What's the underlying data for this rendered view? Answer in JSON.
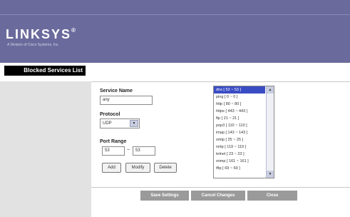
{
  "brand": {
    "logo": "LINKSYS",
    "registered": "®",
    "tagline": "A Division of Cisco Systems, Inc."
  },
  "sidebar": {
    "title": "Blocked Services List"
  },
  "form": {
    "service_name_label": "Service Name",
    "service_name_value": "any",
    "protocol_label": "Protocol",
    "protocol_value": "UDP",
    "port_range_label": "Port Range",
    "port_from": "53",
    "port_separator": "~",
    "port_to": "53",
    "add_label": "Add",
    "modify_label": "Modify",
    "delete_label": "Delete"
  },
  "services": [
    "dns [ 53 ~ 53 ]",
    "ping [ 0 ~ 0 ]",
    "http [ 80 ~ 80 ]",
    "https [ 443 ~ 443 ]",
    "ftp [ 21 ~ 21 ]",
    "pop3 [ 110 ~ 110 ]",
    "imap [ 143 ~ 143 ]",
    "smtp [ 25 ~ 25 ]",
    "nntp [ 119 ~ 119 ]",
    "telnet [ 23 ~ 23 ]",
    "snmp [ 161 ~ 161 ]",
    "tftp [ 69 ~ 69 ]"
  ],
  "selected_service_index": 0,
  "footer": {
    "save": "Save Settings",
    "cancel": "Cancel Changes",
    "close": "Close"
  },
  "colors": {
    "header": "#6a6a9c",
    "selection": "#3a4cc4",
    "footer_button": "#9a9a9a"
  }
}
